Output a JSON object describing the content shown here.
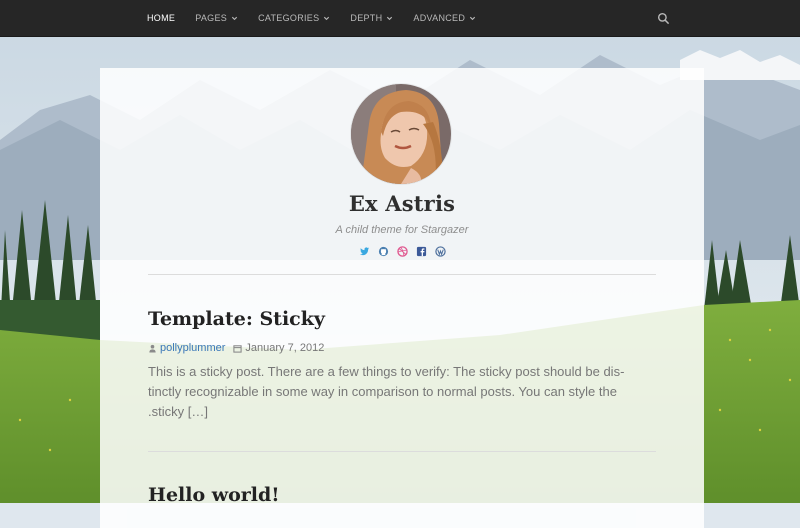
{
  "nav": {
    "items": [
      {
        "label": "HOME",
        "active": true,
        "has_dropdown": false
      },
      {
        "label": "PAGES",
        "active": false,
        "has_dropdown": true
      },
      {
        "label": "CATEGORIES",
        "active": false,
        "has_dropdown": true
      },
      {
        "label": "DEPTH",
        "active": false,
        "has_dropdown": true
      },
      {
        "label": "ADVANCED",
        "active": false,
        "has_dropdown": true
      }
    ],
    "search_icon": "search-icon"
  },
  "site": {
    "title": "Ex Astris",
    "description": "A child theme for Stargazer",
    "social_icons": [
      {
        "name": "twitter-icon",
        "color": "#3aa8e0"
      },
      {
        "name": "github-icon",
        "color": "#4a7fb0"
      },
      {
        "name": "dribbble-icon",
        "color": "#e0578f"
      },
      {
        "name": "facebook-icon",
        "color": "#3b5998"
      },
      {
        "name": "wordpress-icon",
        "color": "#4b6d9b"
      }
    ]
  },
  "posts": [
    {
      "title": "Template: Sticky",
      "author": "pollyplummer",
      "date": "January 7, 2012",
      "excerpt_lines": [
        "This is a sticky post. There are a few things to verify: The sticky post should be dis-",
        "tinctly recognizable in some way in comparison to normal posts. You can style the",
        ".sticky […]"
      ]
    },
    {
      "title": "Hello world!"
    }
  ],
  "colors": {
    "nav_bg": "#262626",
    "link": "#3a77b8",
    "text": "#777777",
    "title": "#222222"
  }
}
